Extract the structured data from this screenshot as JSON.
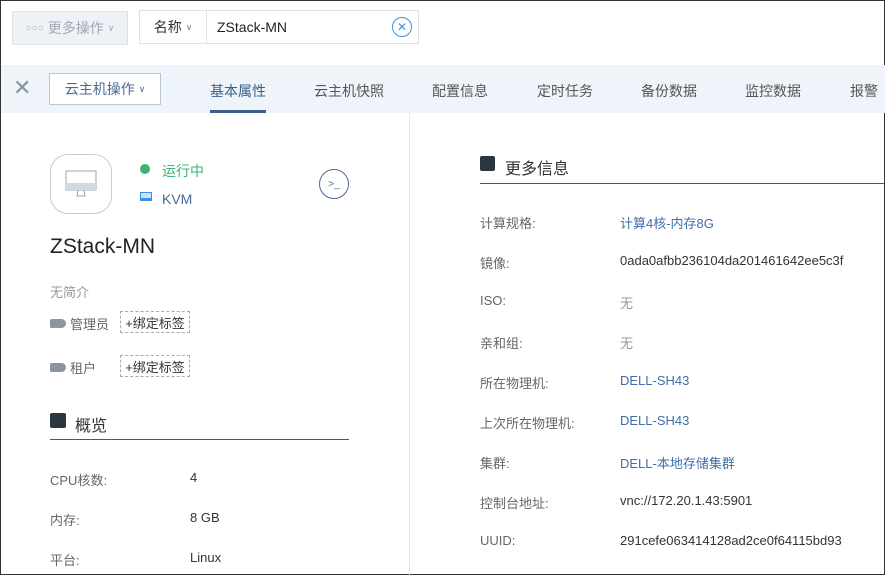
{
  "toolbar": {
    "more_actions": "更多操作",
    "search_field": "名称",
    "search_value": "ZStack-MN"
  },
  "tabs": {
    "vm_actions": "云主机操作",
    "items": [
      "基本属性",
      "云主机快照",
      "配置信息",
      "定时任务",
      "备份数据",
      "监控数据",
      "报警"
    ]
  },
  "vm": {
    "status": "运行中",
    "hypervisor": "KVM",
    "name": "ZStack-MN",
    "description": "无简介",
    "tags": [
      {
        "label": "管理员",
        "button": "+绑定标签"
      },
      {
        "label": "租户",
        "button": "+绑定标签"
      }
    ]
  },
  "overview": {
    "title": "概览",
    "rows": [
      {
        "label": "CPU核数:",
        "value": "4"
      },
      {
        "label": "内存:",
        "value": "8 GB"
      },
      {
        "label": "平台:",
        "value": "Linux"
      }
    ]
  },
  "more_info": {
    "title": "更多信息",
    "rows": [
      {
        "label": "计算规格:",
        "value": "计算4核-内存8G"
      },
      {
        "label": "镜像:",
        "value": "0ada0afbb236104da201461642ee5c3f"
      },
      {
        "label": "ISO:",
        "value": "无"
      },
      {
        "label": "亲和组:",
        "value": "无"
      },
      {
        "label": "所在物理机:",
        "value": "DELL-SH43"
      },
      {
        "label": "上次所在物理机:",
        "value": "DELL-SH43"
      },
      {
        "label": "集群:",
        "value": "DELL-本地存储集群"
      },
      {
        "label": "控制台地址:",
        "value": "vnc://172.20.1.43:5901"
      },
      {
        "label": "UUID:",
        "value": "291cefe063414128ad2ce0f64115bd93"
      }
    ]
  }
}
